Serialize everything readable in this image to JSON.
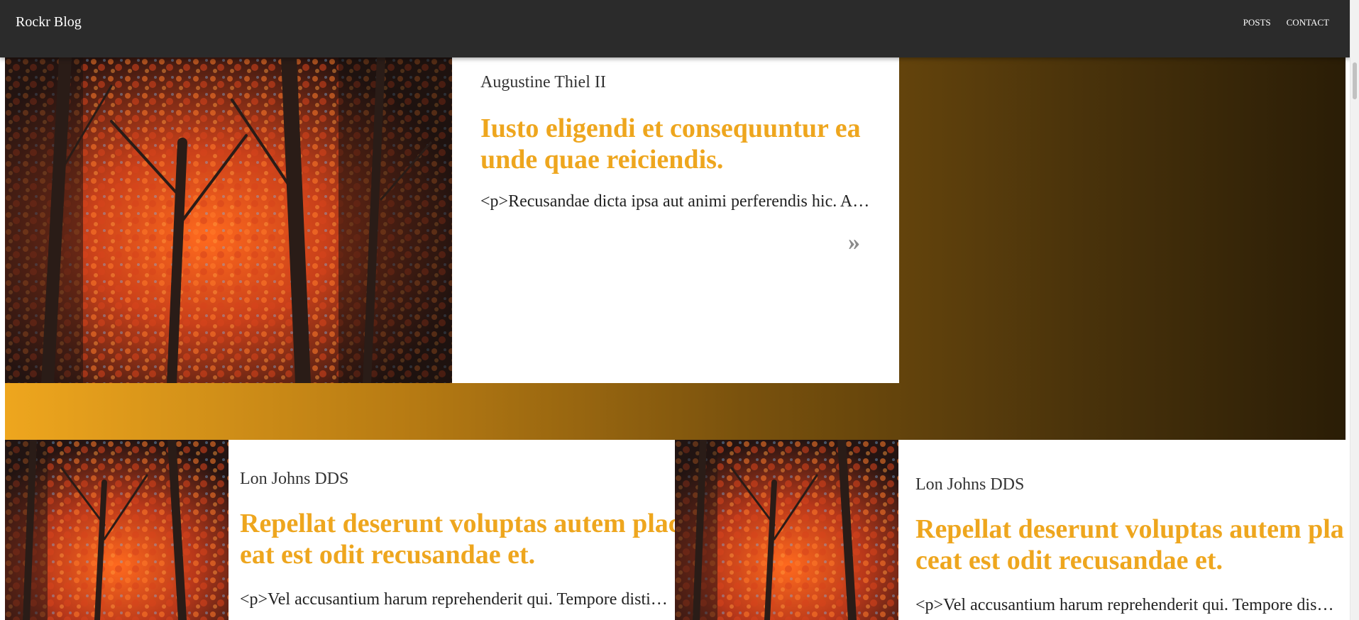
{
  "header": {
    "brand": "Rockr Blog",
    "nav": [
      {
        "label": "POSTS"
      },
      {
        "label": "CONTACT"
      }
    ]
  },
  "featured": {
    "author": "Augustine Thiel II",
    "title": "Iusto eligendi et consequuntur ea unde quae reiciendis.",
    "excerpt": "<p>Recusandae dicta ipsa aut animi perferendis hic. Aut...",
    "read_more": "»"
  },
  "posts": [
    {
      "author": "Lon Johns DDS",
      "title_line1": "Repellat deserunt voluptas autem plac",
      "title_line2": "eat est odit recusandae et.",
      "excerpt": "<p>Vel accusantium harum reprehenderit qui. Tempore distinctio..."
    },
    {
      "author": "Lon Johns DDS",
      "title_line1": "Repellat deserunt voluptas autem pla",
      "title_line2": "ceat est odit recusandae et.",
      "excerpt": "<p>Vel accusantium harum reprehenderit qui. Tempore distinctio..."
    }
  ],
  "colors": {
    "accent": "#eea61e",
    "navbar": "#2b2b2b",
    "gradient_dark": "#2a1d06"
  }
}
